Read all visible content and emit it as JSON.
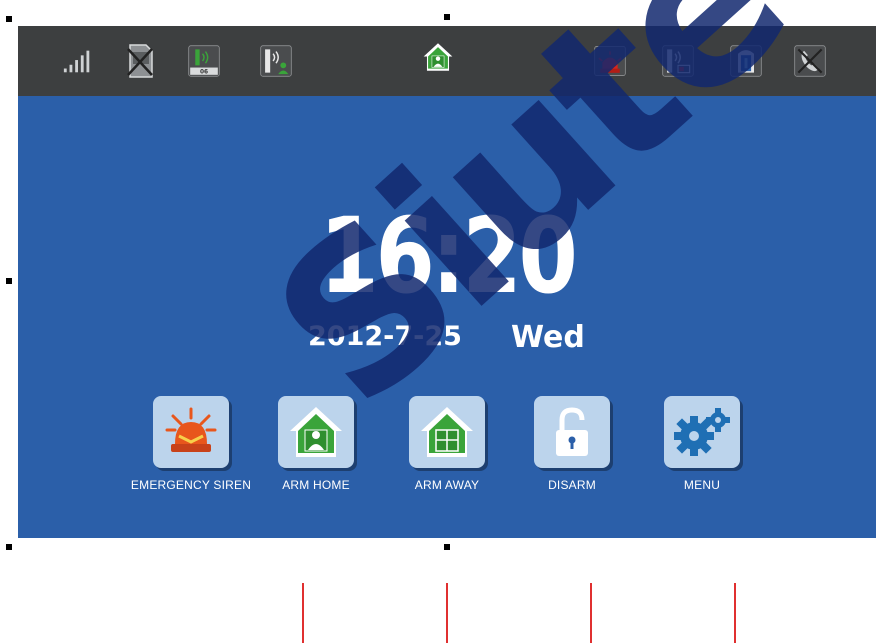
{
  "colors": {
    "screen_bg": "#2b5fa9",
    "top_bar": "#3d3f40",
    "tile_bg": "#bcd4ec",
    "house_green": "#3aa43a",
    "siren_orange": "#e8561c",
    "alarm_red": "#d9241c",
    "guide_line": "#e03030",
    "watermark": "#12286e"
  },
  "status_bar": {
    "icons": [
      {
        "name": "signal-strength-icon"
      },
      {
        "name": "no-sim-card-icon",
        "text": "SIM card"
      },
      {
        "name": "zone-count-icon",
        "text": "06"
      },
      {
        "name": "wireless-user-icon"
      },
      {
        "name": "arm-home-status-icon"
      },
      {
        "name": "alarm-siren-icon"
      },
      {
        "name": "low-battery-icon"
      },
      {
        "name": "door-icon"
      },
      {
        "name": "phone-line-off-icon"
      }
    ]
  },
  "clock": {
    "time": "16:20",
    "date": "2012-7-25",
    "weekday": "Wed"
  },
  "buttons": [
    {
      "label": "EMERGENCY SIREN",
      "icon": "siren-icon"
    },
    {
      "label": "ARM HOME",
      "icon": "house-person-icon"
    },
    {
      "label": "ARM AWAY",
      "icon": "house-icon"
    },
    {
      "label": "DISARM",
      "icon": "unlock-icon"
    },
    {
      "label": "MENU",
      "icon": "gears-icon"
    }
  ],
  "watermark": {
    "text": "Siute"
  }
}
